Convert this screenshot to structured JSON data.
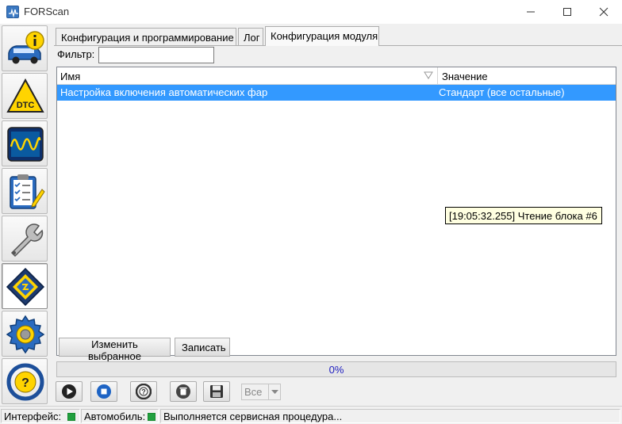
{
  "window": {
    "title": "FORScan"
  },
  "tabs": [
    {
      "label": "Конфигурация и программирование"
    },
    {
      "label": "Лог"
    },
    {
      "label": "Конфигурация модуля"
    }
  ],
  "filter": {
    "label": "Фильтр:",
    "value": ""
  },
  "table": {
    "columns": [
      "Имя",
      "Значение"
    ],
    "rows": [
      {
        "name": "Настройка включения автоматических фар",
        "value": "Стандарт (все остальные)",
        "selected": true
      }
    ]
  },
  "tooltip": {
    "text": "[19:05:32.255] Чтение блока #6"
  },
  "actions": {
    "edit_label": "Изменить выбранное",
    "write_label": "Записать"
  },
  "progress": {
    "percent": 0,
    "text": "0%"
  },
  "toolbar": {
    "select_value": "Все",
    "icons": [
      "play-icon",
      "stop-icon",
      "help-icon",
      "clear-icon",
      "save-icon"
    ]
  },
  "sidebar": {
    "items": [
      {
        "icon": "vehicle-info-icon"
      },
      {
        "icon": "dtc-icon"
      },
      {
        "icon": "oscilloscope-icon"
      },
      {
        "icon": "tests-icon"
      },
      {
        "icon": "service-wrench-icon"
      },
      {
        "icon": "configuration-chip-icon",
        "active": true
      },
      {
        "icon": "settings-gear-icon"
      },
      {
        "icon": "help-steering-icon"
      }
    ]
  },
  "statusbar": {
    "interface_label": "Интерфейс:",
    "car_label": "Автомобиль:",
    "status_text": "Выполняется сервисная процедура...",
    "led_color": "#22a040"
  },
  "colors": {
    "selection": "#3399ff",
    "tooltip_bg": "#ffffe1",
    "progress_text": "#2020c0"
  }
}
